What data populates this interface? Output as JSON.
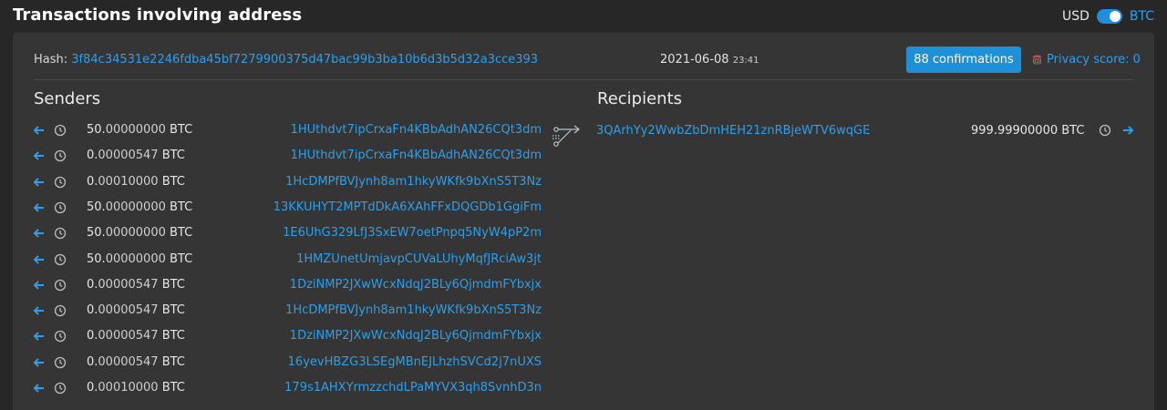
{
  "title": "Transactions involving address",
  "currency_toggle": {
    "left_label": "USD",
    "right_label": "BTC",
    "selected": "BTC"
  },
  "tx": {
    "hash_label": "Hash:",
    "hash": "3f84c34531e2246fdba45bf7279900375d47bac99b3ba10b6d3b5d32a3cce393",
    "date": "2021-06-08",
    "time": "23:41",
    "confirmations": "88 confirmations",
    "privacy_score": "Privacy score: 0"
  },
  "senders_title": "Senders",
  "recipients_title": "Recipients",
  "senders": [
    {
      "int": "50.",
      "dec": "00000000",
      "unit": " BTC",
      "address": "1HUthdvt7ipCrxaFn4KBbAdhAN26CQt3dm"
    },
    {
      "int": "0.",
      "dec": "00000547",
      "unit": " BTC",
      "address": "1HUthdvt7ipCrxaFn4KBbAdhAN26CQt3dm"
    },
    {
      "int": "0.",
      "dec": "00010000",
      "unit": " BTC",
      "address": "1HcDMPfBVJynh8am1hkyWKfk9bXnS5T3Nz"
    },
    {
      "int": "50.",
      "dec": "00000000",
      "unit": " BTC",
      "address": "13KKUHYT2MPTdDkA6XAhFFxDQGDb1GgiFm"
    },
    {
      "int": "50.",
      "dec": "00000000",
      "unit": " BTC",
      "address": "1E6UhG329LfJ3SxEW7oetPnpq5NyW4pP2m"
    },
    {
      "int": "50.",
      "dec": "00000000",
      "unit": " BTC",
      "address": "1HMZUnetUmjavpCUVaLUhyMqfJRciAw3jt"
    },
    {
      "int": "0.",
      "dec": "00000547",
      "unit": " BTC",
      "address": "1DziNMP2JXwWcxNdqJ2BLy6QjmdmFYbxjx"
    },
    {
      "int": "0.",
      "dec": "00000547",
      "unit": " BTC",
      "address": "1HcDMPfBVJynh8am1hkyWKfk9bXnS5T3Nz"
    },
    {
      "int": "0.",
      "dec": "00000547",
      "unit": " BTC",
      "address": "1DziNMP2JXwWcxNdqJ2BLy6QjmdmFYbxjx"
    },
    {
      "int": "0.",
      "dec": "00000547",
      "unit": " BTC",
      "address": "16yevHBZG3LSEgMBnEJLhzhSVCd2j7nUXS"
    },
    {
      "int": "0.",
      "dec": "00010000",
      "unit": " BTC",
      "address": "179s1AHXYrmzzchdLPaMYVX3qh8SvnhD3n"
    }
  ],
  "recipients": [
    {
      "address": "3QArhYy2WwbZbDmHEH21znRBjeWTV6wqGE",
      "int": "999.",
      "dec": "99900000",
      "unit": " BTC"
    }
  ],
  "icons": {
    "sender_arrow": "arrow-left-icon",
    "history": "clock-icon",
    "flow": "transaction-flow-icon",
    "recipient_arrow": "arrow-right-icon",
    "privacy": "fingerprint-icon"
  },
  "colors": {
    "accent": "#2f9ee8",
    "button": "#1d90d8",
    "privacy_icon": "#e2574c"
  }
}
